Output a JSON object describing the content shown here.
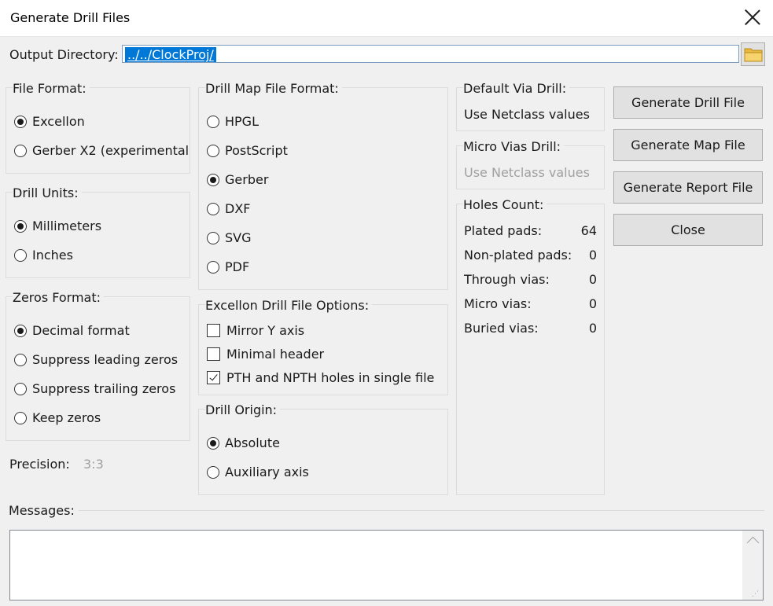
{
  "window": {
    "title": "Generate Drill Files"
  },
  "output_directory": {
    "label": "Output Directory:",
    "value": "../../ClockProj/"
  },
  "file_format": {
    "label": "File Format:",
    "options": [
      {
        "label": "Excellon",
        "selected": true
      },
      {
        "label": "Gerber X2 (experimental",
        "selected": false
      }
    ]
  },
  "drill_units": {
    "label": "Drill Units:",
    "options": [
      {
        "label": "Millimeters",
        "selected": true
      },
      {
        "label": "Inches",
        "selected": false
      }
    ]
  },
  "zeros_format": {
    "label": "Zeros Format:",
    "options": [
      {
        "label": "Decimal format",
        "selected": true
      },
      {
        "label": "Suppress leading zeros",
        "selected": false
      },
      {
        "label": "Suppress trailing zeros",
        "selected": false
      },
      {
        "label": "Keep zeros",
        "selected": false
      }
    ]
  },
  "precision": {
    "label": "Precision:",
    "value": "3:3"
  },
  "drill_map_format": {
    "label": "Drill Map File Format:",
    "options": [
      {
        "label": "HPGL",
        "selected": false
      },
      {
        "label": "PostScript",
        "selected": false
      },
      {
        "label": "Gerber",
        "selected": true
      },
      {
        "label": "DXF",
        "selected": false
      },
      {
        "label": "SVG",
        "selected": false
      },
      {
        "label": "PDF",
        "selected": false
      }
    ]
  },
  "excellon_options": {
    "label": "Excellon Drill File Options:",
    "options": [
      {
        "label": "Mirror Y axis",
        "checked": false
      },
      {
        "label": "Minimal header",
        "checked": false
      },
      {
        "label": "PTH and NPTH holes in single file",
        "checked": true
      }
    ]
  },
  "drill_origin": {
    "label": "Drill Origin:",
    "options": [
      {
        "label": "Absolute",
        "selected": true
      },
      {
        "label": "Auxiliary axis",
        "selected": false
      }
    ]
  },
  "default_via_drill": {
    "label": "Default Via Drill:",
    "value": "Use Netclass values"
  },
  "micro_vias_drill": {
    "label": "Micro Vias Drill:",
    "value": "Use Netclass values"
  },
  "holes_count": {
    "label": "Holes Count:",
    "rows": [
      {
        "label": "Plated pads:",
        "value": "64"
      },
      {
        "label": "Non-plated pads:",
        "value": "0"
      },
      {
        "label": "Through vias:",
        "value": "0"
      },
      {
        "label": "Micro vias:",
        "value": "0"
      },
      {
        "label": "Buried vias:",
        "value": "0"
      }
    ]
  },
  "buttons": {
    "generate_drill": "Generate Drill File",
    "generate_map": "Generate Map File",
    "generate_report": "Generate Report File",
    "close": "Close"
  },
  "messages": {
    "label": "Messages:"
  },
  "icons": {
    "close": "close-icon",
    "folder": "folder-icon",
    "scroll_up": "chevron-up-icon"
  },
  "colors": {
    "selection": "#0078d7",
    "folder": "#f4c85a"
  }
}
